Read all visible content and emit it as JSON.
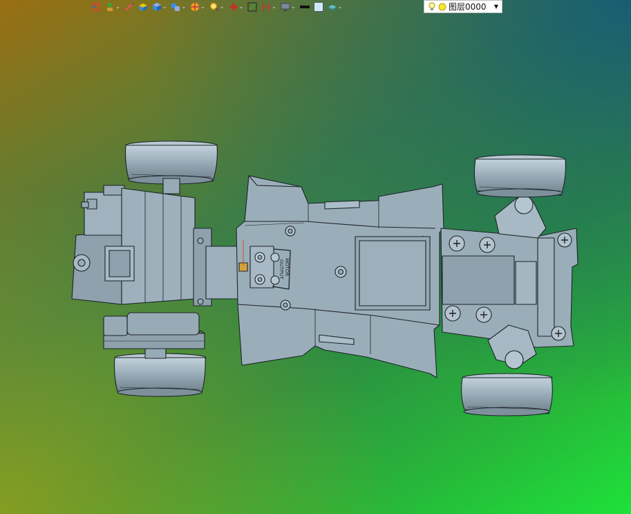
{
  "toolbar": {
    "buttons": [
      {
        "icon": "export-icon",
        "dropdown": false
      },
      {
        "icon": "tree-icon",
        "dropdown": true
      },
      {
        "icon": "pen-icon",
        "dropdown": false
      },
      {
        "icon": "box-face-icon",
        "dropdown": false
      },
      {
        "icon": "cube-icon",
        "dropdown": true
      },
      {
        "icon": "views-icon",
        "dropdown": true
      },
      {
        "icon": "render-ball-icon",
        "dropdown": true
      },
      {
        "icon": "zoom-icon",
        "dropdown": true
      },
      {
        "icon": "origin-icon",
        "dropdown": true
      },
      {
        "icon": "sketch-icon",
        "dropdown": false
      },
      {
        "icon": "section-icon",
        "dropdown": true
      },
      {
        "icon": "display-icon",
        "dropdown": true
      },
      {
        "icon": "line-color-icon",
        "dropdown": false
      },
      {
        "icon": "fill-color-icon",
        "dropdown": false
      },
      {
        "icon": "layer-stack-icon",
        "dropdown": true
      }
    ],
    "layer": {
      "name": "图层0000"
    }
  },
  "model": {
    "label_line1": "MOTOR",
    "label_line2": "OUTPUT"
  },
  "colors": {
    "part": "#97aab6",
    "edge": "#1c2226",
    "shade": "#7d909b"
  }
}
